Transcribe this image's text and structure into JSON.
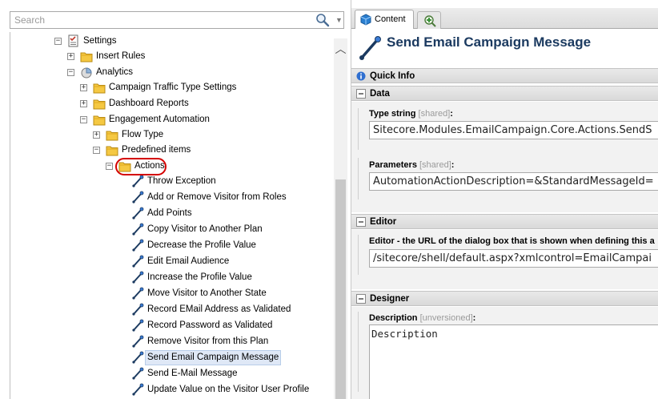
{
  "search": {
    "placeholder": "Search"
  },
  "tree": {
    "items": [
      {
        "label": "Settings"
      },
      {
        "label": "Insert Rules"
      },
      {
        "label": "Analytics"
      },
      {
        "label": "Campaign Traffic Type Settings"
      },
      {
        "label": "Dashboard Reports"
      },
      {
        "label": "Engagement Automation"
      },
      {
        "label": "Flow Type"
      },
      {
        "label": "Predefined items"
      },
      {
        "label": "Actions"
      },
      {
        "label": "Throw Exception"
      },
      {
        "label": "Add or Remove Visitor from Roles"
      },
      {
        "label": "Add Points"
      },
      {
        "label": "Copy Visitor to Another Plan"
      },
      {
        "label": "Decrease the Profile Value"
      },
      {
        "label": "Edit Email Audience"
      },
      {
        "label": "Increase the Profile Value"
      },
      {
        "label": "Move Visitor to Another State"
      },
      {
        "label": "Record EMail Address as Validated"
      },
      {
        "label": "Record Password as Validated"
      },
      {
        "label": "Remove Visitor from this Plan"
      },
      {
        "label": "Send Email Campaign Message"
      },
      {
        "label": "Send E-Mail Message"
      },
      {
        "label": "Update Value on the Visitor User Profile"
      }
    ]
  },
  "tabs": {
    "content": "Content"
  },
  "item": {
    "title": "Send Email Campaign Message"
  },
  "sections": {
    "quick_info": "Quick Info",
    "data": "Data",
    "editor": "Editor",
    "designer": "Designer"
  },
  "fields": {
    "type_string": {
      "label": "Type string",
      "meta": "[shared]",
      "value": "Sitecore.Modules.EmailCampaign.Core.Actions.SendS"
    },
    "parameters": {
      "label": "Parameters",
      "meta": "[shared]",
      "value": "AutomationActionDescription=&StandardMessageId="
    },
    "editor_url": {
      "label": "Editor - the URL of the dialog box that is shown when defining this a",
      "value": "/sitecore/shell/default.aspx?xmlcontrol=EmailCampai"
    },
    "description": {
      "label": "Description",
      "meta": "[unversioned]",
      "value": "Description"
    }
  },
  "colors": {
    "accent": "#1b3a60",
    "selection": "#dfe8f6",
    "highlight_ring": "#d40000"
  }
}
